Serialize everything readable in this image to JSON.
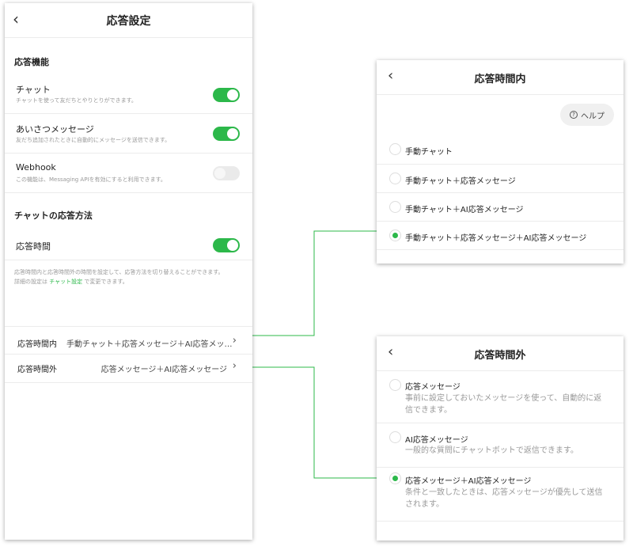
{
  "main": {
    "title": "応答設定",
    "section_features": "応答機能",
    "toggles": [
      {
        "title": "チャット",
        "desc": "チャットを使って友だちとやりとりができます。",
        "on": true
      },
      {
        "title": "あいさつメッセージ",
        "desc": "友だち追加されたときに自動的にメッセージを送信できます。",
        "on": true
      },
      {
        "title": "Webhook",
        "desc": "この機能は、Messaging APIを有効にすると利用できます。",
        "on": false
      }
    ],
    "section_method": "チャットの応答方法",
    "response_time": {
      "title": "応答時間",
      "on": true
    },
    "note_line1": "応答時間内と応答時間外の時間を設定して、応答方法を切り替えることができます。",
    "note_prefix": "詳細の設定は",
    "note_link": "チャット設定",
    "note_suffix": "で変更できます。",
    "within": {
      "label": "応答時間内",
      "value": "手動チャット＋応答メッセージ＋AI応答メッ…"
    },
    "outside": {
      "label": "応答時間外",
      "value": "応答メッセージ＋AI応答メッセージ"
    }
  },
  "panel_within": {
    "title": "応答時間内",
    "help": "ヘルプ",
    "options": [
      {
        "label": "手動チャット",
        "selected": false
      },
      {
        "label": "手動チャット＋応答メッセージ",
        "selected": false
      },
      {
        "label": "手動チャット＋AI応答メッセージ",
        "selected": false
      },
      {
        "label": "手動チャット＋応答メッセージ＋AI応答メッセージ",
        "selected": true
      }
    ]
  },
  "panel_outside": {
    "title": "応答時間外",
    "options": [
      {
        "label": "応答メッセージ",
        "desc": "事前に設定しておいたメッセージを使って、自動的に返信できます。",
        "selected": false
      },
      {
        "label": "AI応答メッセージ",
        "desc": "一般的な質問にチャットボットで返信できます。",
        "selected": false
      },
      {
        "label": "応答メッセージ＋AI応答メッセージ",
        "desc": "条件と一致したときは、応答メッセージが優先して送信されます。",
        "selected": true
      }
    ]
  },
  "colors": {
    "accent": "#2cb84a",
    "connector": "#2cb84a"
  }
}
